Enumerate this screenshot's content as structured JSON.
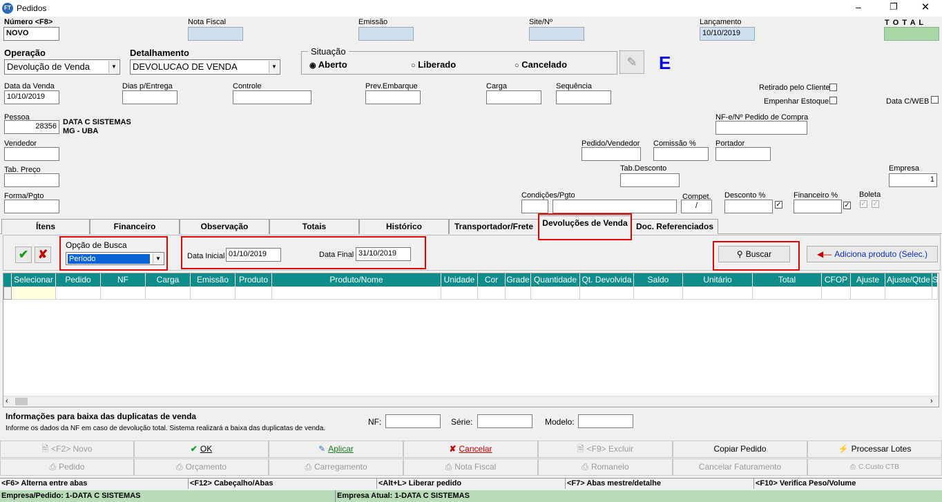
{
  "window": {
    "title": "Pedidos",
    "app_icon": "FT"
  },
  "header": {
    "numero": {
      "label": "Número <F8>",
      "value": "NOVO"
    },
    "nota_fiscal": {
      "label": "Nota Fiscal",
      "value": ""
    },
    "emissao": {
      "label": "Emissão",
      "value": ""
    },
    "site": {
      "label": "Site/Nº",
      "value": ""
    },
    "lancamento": {
      "label": "Lançamento",
      "value": "10/10/2019"
    },
    "total": {
      "label": "T O T A L",
      "value": ""
    }
  },
  "operacao": {
    "label": "Operação",
    "value": "Devolução de Venda"
  },
  "detalhamento": {
    "label": "Detalhamento",
    "value": "DEVOLUCAO DE VENDA"
  },
  "situacao": {
    "label": "Situação",
    "options": [
      {
        "label": "Aberto",
        "selected": true
      },
      {
        "label": "Liberado",
        "selected": false
      },
      {
        "label": "Cancelado",
        "selected": false
      }
    ],
    "mark": "E"
  },
  "row2": {
    "data_venda": {
      "label": "Data da Venda",
      "value": "10/10/2019"
    },
    "dias_entrega": {
      "label": "Dias p/Entrega",
      "value": ""
    },
    "controle": {
      "label": "Controle",
      "value": ""
    },
    "prev_embarque": {
      "label": "Prev.Embarque",
      "value": ""
    },
    "carga": {
      "label": "Carga",
      "value": ""
    },
    "sequencia": {
      "label": "Sequência",
      "value": ""
    },
    "retirado": {
      "label": "Retirado pelo Cliente",
      "checked": false
    },
    "empenhar": {
      "label": "Empenhar Estoque",
      "checked": false
    },
    "data_cweb": {
      "label": "Data C/WEB",
      "checked": false
    }
  },
  "pessoa": {
    "label": "Pessoa",
    "value": "28356",
    "name": "DATA C SISTEMAS",
    "city": "MG -  UBA"
  },
  "nfe_pedido": {
    "label": "NF-e/Nº Pedido de Compra",
    "value": ""
  },
  "vendedor": {
    "label": "Vendedor",
    "value": ""
  },
  "pedido_vendedor": {
    "label": "Pedido/Vendedor",
    "value": ""
  },
  "comissao": {
    "label": "Comissão %",
    "value": ""
  },
  "portador": {
    "label": "Portador",
    "value": ""
  },
  "tab_preco": {
    "label": "Tab. Preço",
    "value": ""
  },
  "tab_desconto": {
    "label": "Tab.Desconto",
    "value": ""
  },
  "empresa": {
    "label": "Empresa",
    "value": "1"
  },
  "forma_pgto": {
    "label": "Forma/Pgto",
    "value": ""
  },
  "condicoes": {
    "label": "Condições/Pgto",
    "value": ""
  },
  "compet": {
    "label": "Compet.",
    "value": "/"
  },
  "desconto": {
    "label": "Desconto %",
    "value": "",
    "checked": true
  },
  "financeiro_pct": {
    "label": "Financeiro %",
    "value": "",
    "checked": true
  },
  "boleta": {
    "label": "Boleta",
    "checked": [
      true,
      true
    ]
  },
  "tabs": [
    "Ítens",
    "Financeiro",
    "Observação",
    "Totais",
    "Histórico",
    "Transportador/Frete",
    "Devoluções de Venda",
    "Doc. Referenciados"
  ],
  "devolucoes": {
    "opcao_busca": {
      "label": "Opção de Busca",
      "value": "Período"
    },
    "data_inicial": {
      "label": "Data Inicial",
      "value": "01/10/2019"
    },
    "data_final": {
      "label": "Data Final",
      "value": "31/10/2019"
    },
    "buscar_label": "Buscar",
    "adiciona_label": "Adiciona produto (Selec.)"
  },
  "grid": {
    "columns": [
      "Selecionar",
      "Pedido",
      "NF",
      "Carga",
      "Emissão",
      "Produto",
      "Produto/Nome",
      "Unidade",
      "Cor",
      "Grade",
      "Quantidade",
      "Qt. Devolvida",
      "Saldo",
      "Unitário",
      "Total",
      "CFOP",
      "Ajuste",
      "Ajuste/Qtde",
      "S"
    ]
  },
  "info": {
    "title": "Informações para baixa das duplicatas de venda",
    "desc": "Informe os dados da NF em caso de devolução total. Sistema realizará a baixa das duplicatas de venda.",
    "nf_label": "NF:",
    "serie_label": "Série:",
    "modelo_label": "Modelo:"
  },
  "buttons_row1": [
    "<F2> Novo",
    "OK",
    "Aplicar",
    "Cancelar",
    "<F9> Excluir",
    "Copiar Pedido",
    "Processar Lotes"
  ],
  "buttons_row2": [
    "Pedido",
    "Orçamento",
    "Carregamento",
    "Nota Fiscal",
    "Romaneio",
    "Cancelar Faturamento",
    "C.Custo CTB"
  ],
  "shortcuts": [
    "<F6> Alterna entre abas",
    "<F12> Cabeçalho/Abas",
    "<Alt+L> Liberar pedido",
    "<F7> Abas mestre/detalhe",
    "<F10> Verifica Peso/Volume"
  ],
  "status": [
    "Empresa/Pedido: 1-DATA C SISTEMAS",
    "Empresa Atual: 1-DATA C SISTEMAS"
  ],
  "colors": {
    "grid_header": "#0f8d8d",
    "highlight": "#e00000",
    "status": "#b8dcb8",
    "mark": "#0000e0"
  }
}
